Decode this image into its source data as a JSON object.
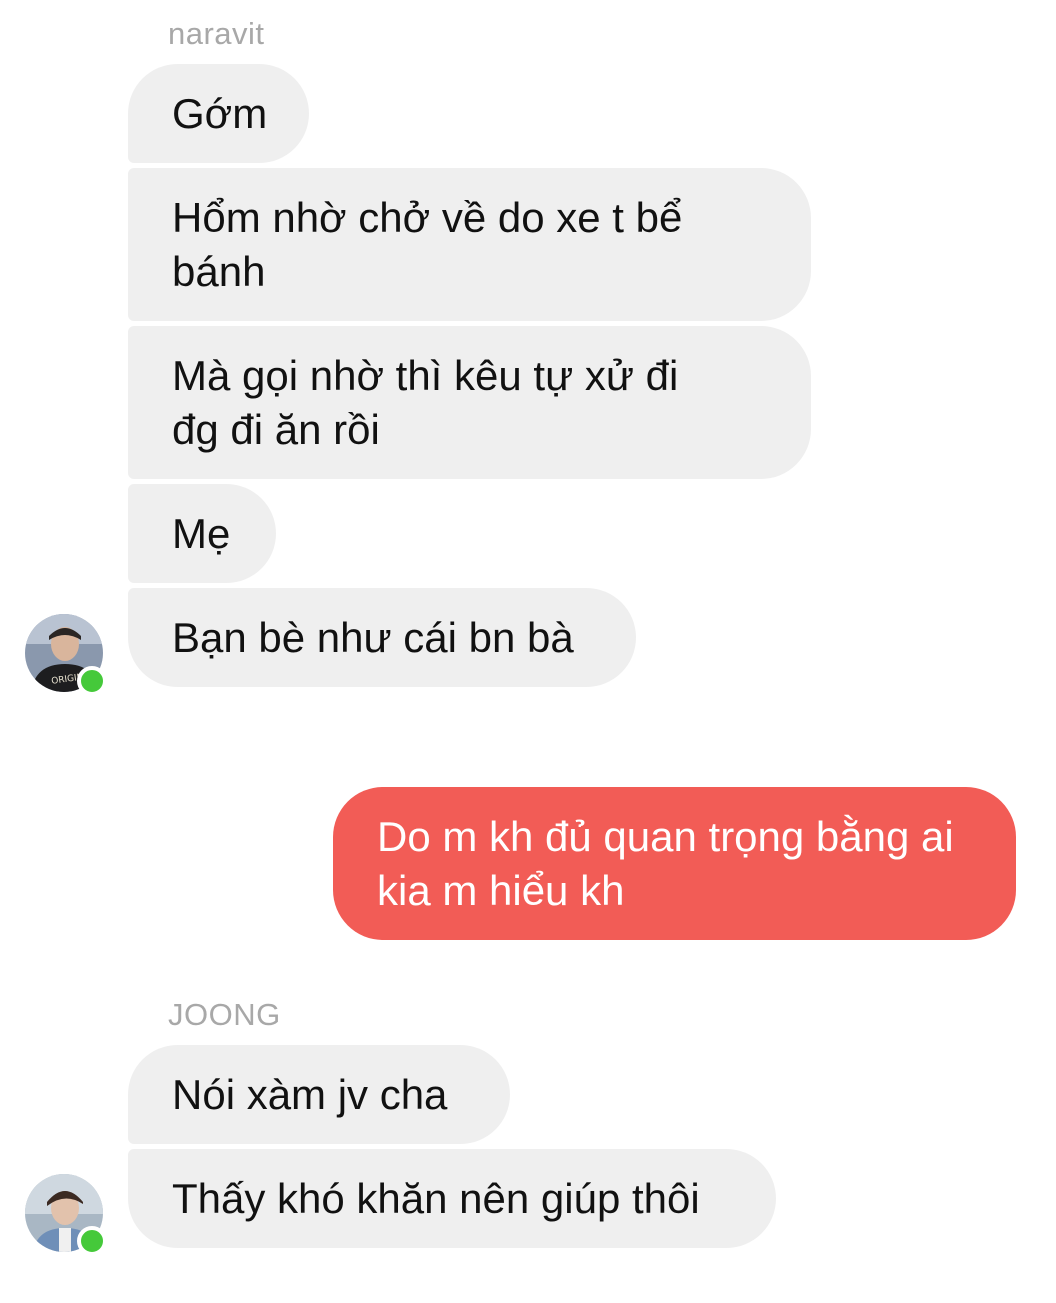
{
  "conversation": {
    "group1": {
      "sender": "naravit",
      "messages": [
        "Gớm",
        "Hổm nhờ chở về do xe t bể\nbánh",
        "Mà gọi nhờ thì kêu tự xử đi\nđg đi ăn rồi",
        "Mẹ",
        "Bạn bè như cái bn bà"
      ],
      "avatar_status": "online"
    },
    "outgoing": {
      "message": "Do m kh đủ quan trọng bằng ai\nkia m hiểu kh",
      "bubble_color": "#f25c56"
    },
    "group2": {
      "sender": "JOONG",
      "messages": [
        "Nói xàm jv cha",
        "Thấy khó khăn nên giúp thôi"
      ],
      "avatar_status": "online"
    }
  },
  "colors": {
    "incoming_bubble": "#efefef",
    "outgoing_bubble": "#f25c56",
    "online_indicator": "#45c93a",
    "sender_name": "#a8a8a8"
  },
  "icons": {
    "avatar1": "avatar-icon",
    "avatar2": "avatar-icon",
    "online": "online-status-icon"
  }
}
